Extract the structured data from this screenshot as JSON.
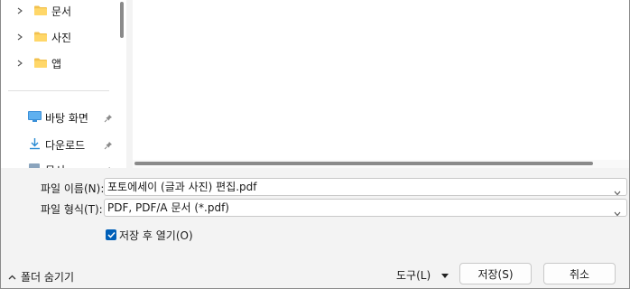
{
  "nav": {
    "items": [
      {
        "label": "문서"
      },
      {
        "label": "사진"
      },
      {
        "label": "앱"
      }
    ],
    "quick": [
      {
        "label": "바탕 화면"
      },
      {
        "label": "다운로드"
      },
      {
        "label": "문서"
      }
    ]
  },
  "form": {
    "filename_label": "파일 이름(N):",
    "filename_value": "포토에세이 (글과 사진) 편집.pdf",
    "filetype_label": "파일 형식(T):",
    "filetype_value": "PDF, PDF/A 문서 (*.pdf)",
    "open_after_label": "저장 후 열기(O)",
    "open_after_checked": true
  },
  "footer": {
    "hide_folders_label": "폴더 숨기기",
    "tools_label": "도구(L)",
    "save_label": "저장(S)",
    "cancel_label": "취소"
  },
  "colors": {
    "accent": "#005fb8",
    "folder": "#f2c14e"
  }
}
